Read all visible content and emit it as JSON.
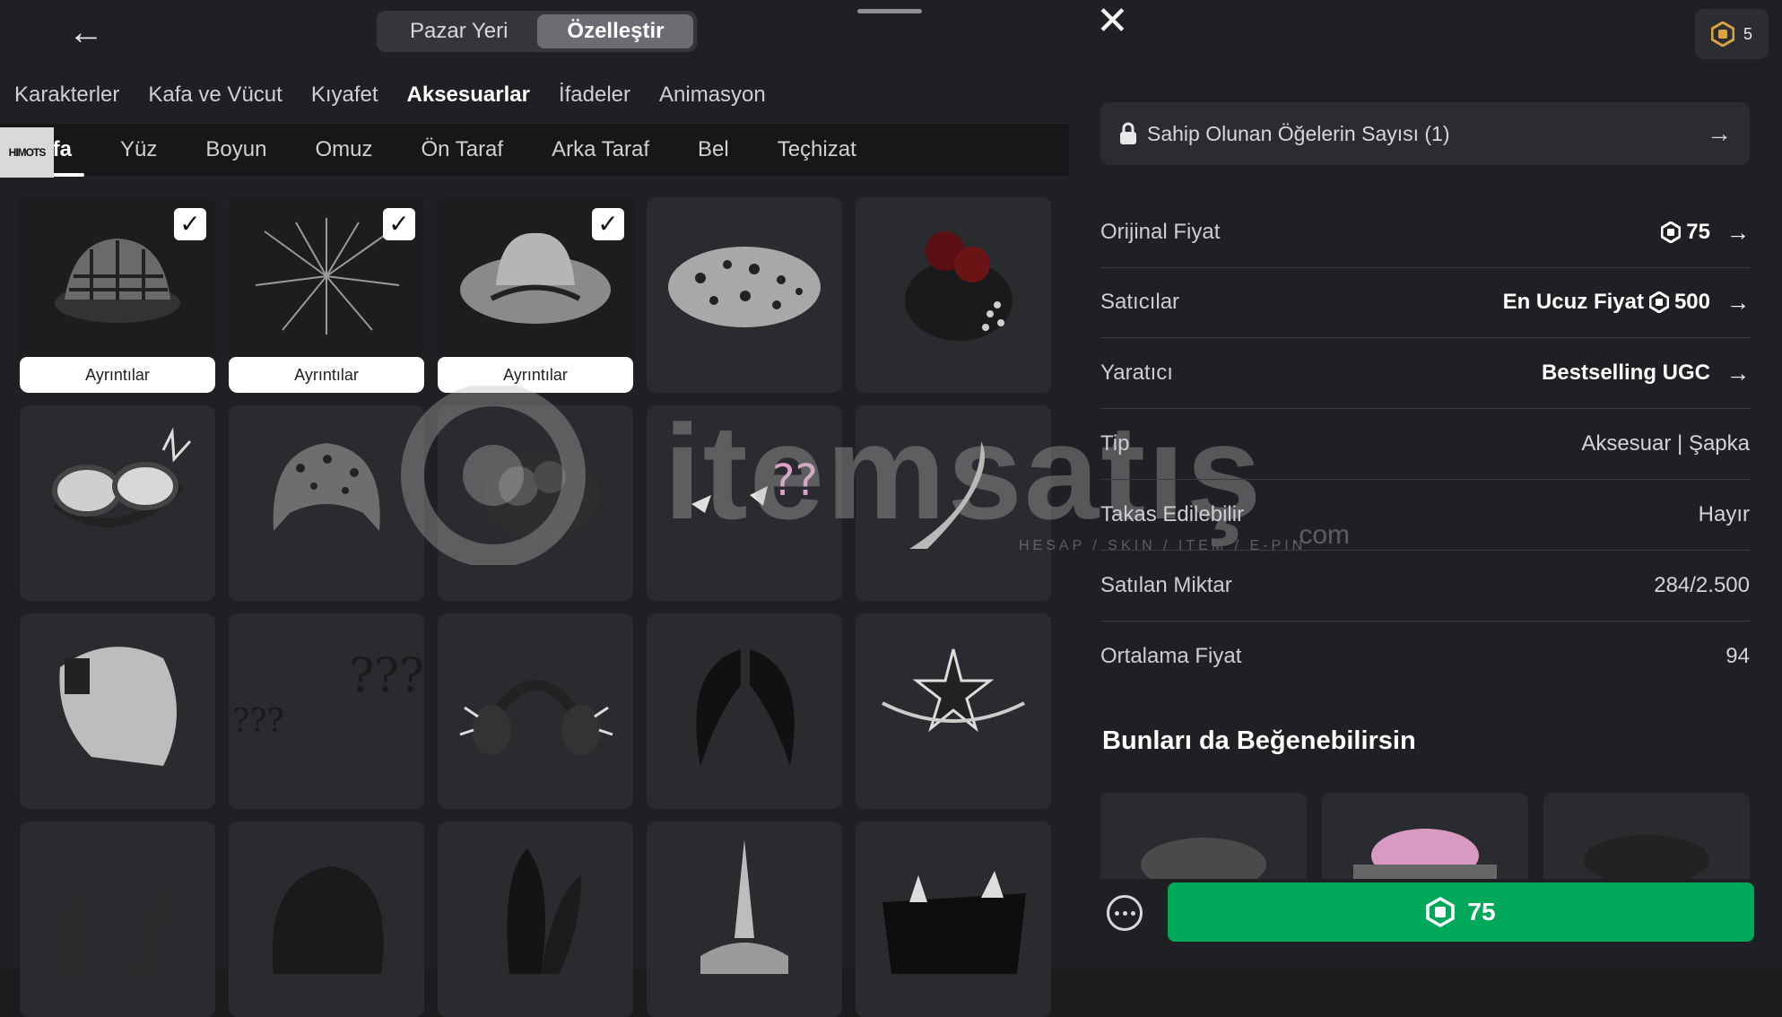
{
  "header": {
    "tabs": [
      "Pazar Yeri",
      "Özelleştir"
    ],
    "active_tab": "Özelleştir",
    "robux_balance": "5"
  },
  "categories": [
    "Karakterler",
    "Kafa ve Vücut",
    "Kıyafet",
    "Aksesuarlar",
    "İfadeler",
    "Animasyon"
  ],
  "subcategories": [
    "Kafa",
    "Yüz",
    "Boyun",
    "Omuz",
    "Ön Taraf",
    "Arka Taraf",
    "Bel",
    "Teçhizat"
  ],
  "overlay_tag": "HIMOTS",
  "grid": {
    "details_label": "Ayrıntılar",
    "question_marks_large": "???",
    "question_marks_small": "???"
  },
  "item": {
    "owned_label": "Sahip Olunan Öğelerin Sayısı (1)",
    "rows": {
      "original_price": {
        "label": "Orijinal Fiyat",
        "value": "75"
      },
      "sellers": {
        "label": "Satıcılar",
        "prefix": "En Ucuz Fiyat",
        "value": "500"
      },
      "creator": {
        "label": "Yaratıcı",
        "value": "Bestselling UGC"
      },
      "type": {
        "label": "Tip",
        "value": "Aksesuar | Şapka"
      },
      "tradable": {
        "label": "Takas Edilebilir",
        "value": "Hayır"
      },
      "sold": {
        "label": "Satılan Miktar",
        "value": "284/2.500"
      },
      "avg_price": {
        "label": "Ortalama Fiyat",
        "value": "94"
      }
    },
    "recommend_title": "Bunları da Beğenebilirsin",
    "buy_price": "75"
  },
  "watermark": {
    "text": "itemsatış",
    "domain": ".com",
    "tagline": "HESAP / SKIN / ITEM / E-PIN"
  },
  "colors": {
    "buy": "#00a85a",
    "background": "#1f2023",
    "card": "#2a2b2e"
  }
}
